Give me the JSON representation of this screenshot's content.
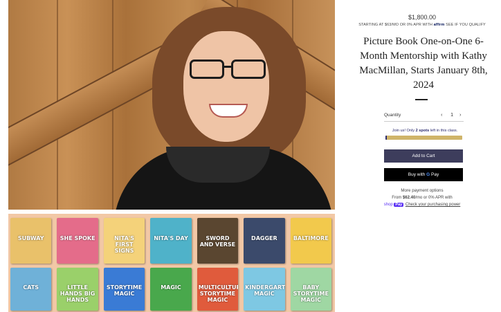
{
  "product": {
    "price": "$1,800.00",
    "affirm_prefix": "STARTING AT $63/MO OR 0% APR WITH",
    "affirm_brand": "affirm",
    "affirm_suffix": "SEE IF YOU QUALIFY",
    "title": "Picture Book One-on-One 6-Month Mentorship with Kathy MacMillan, Starts January 8th, 2024"
  },
  "quantity": {
    "label": "Quantity",
    "decrement": "‹",
    "value": "1",
    "increment": "›"
  },
  "availability": {
    "text_prefix": "Join us! Only",
    "count": "2 spots",
    "text_suffix": "left in this class.",
    "fill_fraction": 0.02
  },
  "buttons": {
    "add_to_cart": "Add to Cart",
    "buy_with": "Buy with",
    "gpay_g": "G",
    "gpay_pay": "Pay"
  },
  "payment": {
    "more_options": "More payment options",
    "from_prefix": "From",
    "from_amount": "$62.40",
    "from_suffix": "/mo or 0% APR with",
    "shop_logo": "shop",
    "shop_pay_badge": "Pay",
    "check_power": "Check your purchasing power"
  },
  "books": [
    {
      "title": "SUBWAY",
      "color": "#e9c16a"
    },
    {
      "title": "SHE SPOKE",
      "color": "#e46c8a"
    },
    {
      "title": "NITA'S FIRST SIGNS",
      "color": "#f4d27a"
    },
    {
      "title": "NITA'S DAY",
      "color": "#4fb2c9"
    },
    {
      "title": "SWORD AND VERSE",
      "color": "#5a4630"
    },
    {
      "title": "DAGGER",
      "color": "#3b4a6b"
    },
    {
      "title": "BALTIMORE",
      "color": "#f2c94c"
    },
    {
      "title": "CATS",
      "color": "#6fb1d8"
    },
    {
      "title": "LITTLE HANDS BIG HANDS",
      "color": "#9ad06a"
    },
    {
      "title": "STORYTIME MAGIC",
      "color": "#3a7bd5"
    },
    {
      "title": "MAGIC",
      "color": "#49a84c"
    },
    {
      "title": "MULTICULTURAL STORYTIME MAGIC",
      "color": "#e05b3c"
    },
    {
      "title": "KINDERGARTEN MAGIC",
      "color": "#7ec8e3"
    },
    {
      "title": "BABY STORYTIME MAGIC",
      "color": "#9fd7a3"
    }
  ]
}
